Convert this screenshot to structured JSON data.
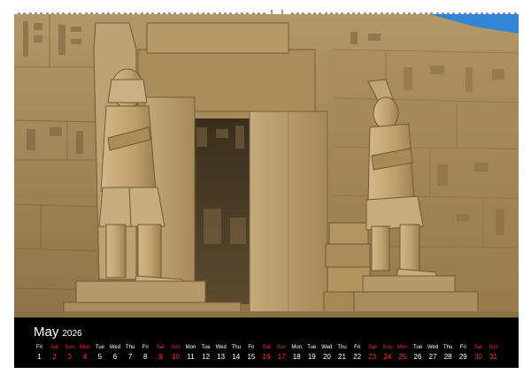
{
  "calendar": {
    "month": "May",
    "year": "2026",
    "days": [
      {
        "wd": "Fri",
        "d": "1",
        "weekend": false
      },
      {
        "wd": "Sat",
        "d": "2",
        "weekend": true
      },
      {
        "wd": "Sun",
        "d": "3",
        "weekend": true
      },
      {
        "wd": "Mon",
        "d": "4",
        "weekend": true
      },
      {
        "wd": "Tue",
        "d": "5",
        "weekend": false
      },
      {
        "wd": "Wed",
        "d": "6",
        "weekend": false
      },
      {
        "wd": "Thu",
        "d": "7",
        "weekend": false
      },
      {
        "wd": "Fri",
        "d": "8",
        "weekend": false
      },
      {
        "wd": "Sat",
        "d": "9",
        "weekend": true
      },
      {
        "wd": "Sun",
        "d": "10",
        "weekend": true
      },
      {
        "wd": "Mon",
        "d": "11",
        "weekend": false
      },
      {
        "wd": "Tue",
        "d": "12",
        "weekend": false
      },
      {
        "wd": "Wed",
        "d": "13",
        "weekend": false
      },
      {
        "wd": "Thu",
        "d": "14",
        "weekend": false
      },
      {
        "wd": "Fri",
        "d": "15",
        "weekend": false
      },
      {
        "wd": "Sat",
        "d": "16",
        "weekend": true
      },
      {
        "wd": "Sun",
        "d": "17",
        "weekend": true
      },
      {
        "wd": "Mon",
        "d": "18",
        "weekend": false
      },
      {
        "wd": "Tue",
        "d": "19",
        "weekend": false
      },
      {
        "wd": "Wed",
        "d": "20",
        "weekend": false
      },
      {
        "wd": "Thu",
        "d": "21",
        "weekend": false
      },
      {
        "wd": "Fri",
        "d": "22",
        "weekend": false
      },
      {
        "wd": "Sat",
        "d": "23",
        "weekend": true
      },
      {
        "wd": "Sun",
        "d": "24",
        "weekend": true
      },
      {
        "wd": "Mon",
        "d": "25",
        "weekend": true
      },
      {
        "wd": "Tue",
        "d": "26",
        "weekend": false
      },
      {
        "wd": "Wed",
        "d": "27",
        "weekend": false
      },
      {
        "wd": "Thu",
        "d": "28",
        "weekend": false
      },
      {
        "wd": "Fri",
        "d": "29",
        "weekend": false
      },
      {
        "wd": "Sat",
        "d": "30",
        "weekend": true
      },
      {
        "wd": "Sun",
        "d": "31",
        "weekend": true
      }
    ]
  },
  "colors": {
    "weekend": "#ff2b2b",
    "bar": "#000000",
    "stone": "#a68a58",
    "sky": "#2f86d6"
  }
}
